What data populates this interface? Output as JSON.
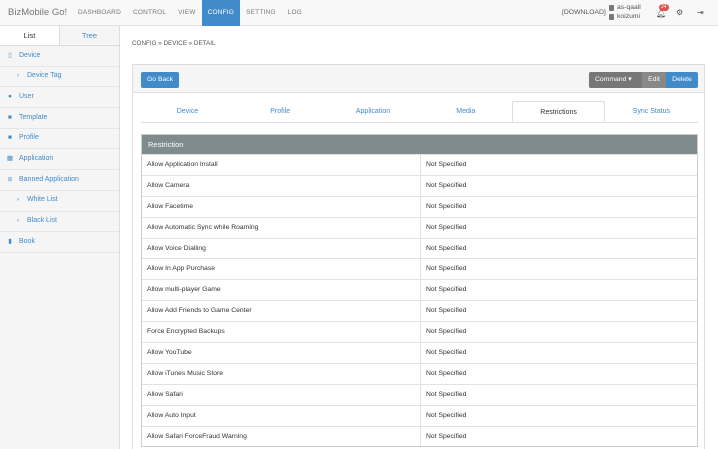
{
  "app": {
    "brand": "BizMobile Go!"
  },
  "nav": [
    "DASHBOARD",
    "CONTROL",
    "VIEW",
    "CONFIG",
    "SETTING",
    "LOG"
  ],
  "header": {
    "download": "[DOWNLOAD]",
    "user1": "as-qaall",
    "user2": "koizumi",
    "notif_count": "24"
  },
  "sidebar": {
    "tabs": [
      "List",
      "Tree"
    ],
    "items": [
      {
        "label": "Device",
        "icon": "mobile-icon",
        "glyph": "▯",
        "sub": false
      },
      {
        "label": "Device Tag",
        "icon": "chevron-right-icon",
        "glyph": "›",
        "sub": true
      },
      {
        "label": "User",
        "icon": "user-icon",
        "glyph": "●",
        "sub": false
      },
      {
        "label": "Template",
        "icon": "file-icon",
        "glyph": "■",
        "sub": false
      },
      {
        "label": "Profile",
        "icon": "file-icon",
        "glyph": "■",
        "sub": false
      },
      {
        "label": "Application",
        "icon": "grid-icon",
        "glyph": "▦",
        "sub": false
      },
      {
        "label": "Banned Application",
        "icon": "ban-icon",
        "glyph": "⊘",
        "sub": false
      },
      {
        "label": "White List",
        "icon": "chevron-right-icon",
        "glyph": "›",
        "sub": true
      },
      {
        "label": "Black List",
        "icon": "chevron-right-icon",
        "glyph": "›",
        "sub": true
      },
      {
        "label": "Book",
        "icon": "book-icon",
        "glyph": "▮",
        "sub": false
      }
    ]
  },
  "breadcrumb": "CONFIG » DEVICE » DETAIL",
  "toolbar": {
    "back": "Go Back",
    "command": "Command ▾",
    "edit": "Edit",
    "delete": "Delete"
  },
  "tabs": [
    "Device",
    "Profile",
    "Application",
    "Media",
    "Restrictions",
    "Sync Status"
  ],
  "active_tab": "Restrictions",
  "restriction": {
    "header": "Restriction",
    "rows": [
      [
        "Allow Application Install",
        "Not Specified"
      ],
      [
        "Allow Camera",
        "Not Specified"
      ],
      [
        "Allow Facetime",
        "Not Specified"
      ],
      [
        "Allow Automatic Sync while Roaming",
        "Not Specified"
      ],
      [
        "Allow Voice Dialling",
        "Not Specified"
      ],
      [
        "Allow In App Purchase",
        "Not Specified"
      ],
      [
        "Allow multi-player Game",
        "Not Specified"
      ],
      [
        "Allow Add Friends to Game Center",
        "Not Specified"
      ],
      [
        "Force Encrypted Backups",
        "Not Specified"
      ],
      [
        "Allow YouTube",
        "Not Specified"
      ],
      [
        "Allow iTunes Music Store",
        "Not Specified"
      ],
      [
        "Allow Safari",
        "Not Specified"
      ],
      [
        "Allow Auto Input",
        "Not Specified"
      ],
      [
        "Allow Safari ForceFraud Warning",
        "Not Specified"
      ]
    ]
  }
}
